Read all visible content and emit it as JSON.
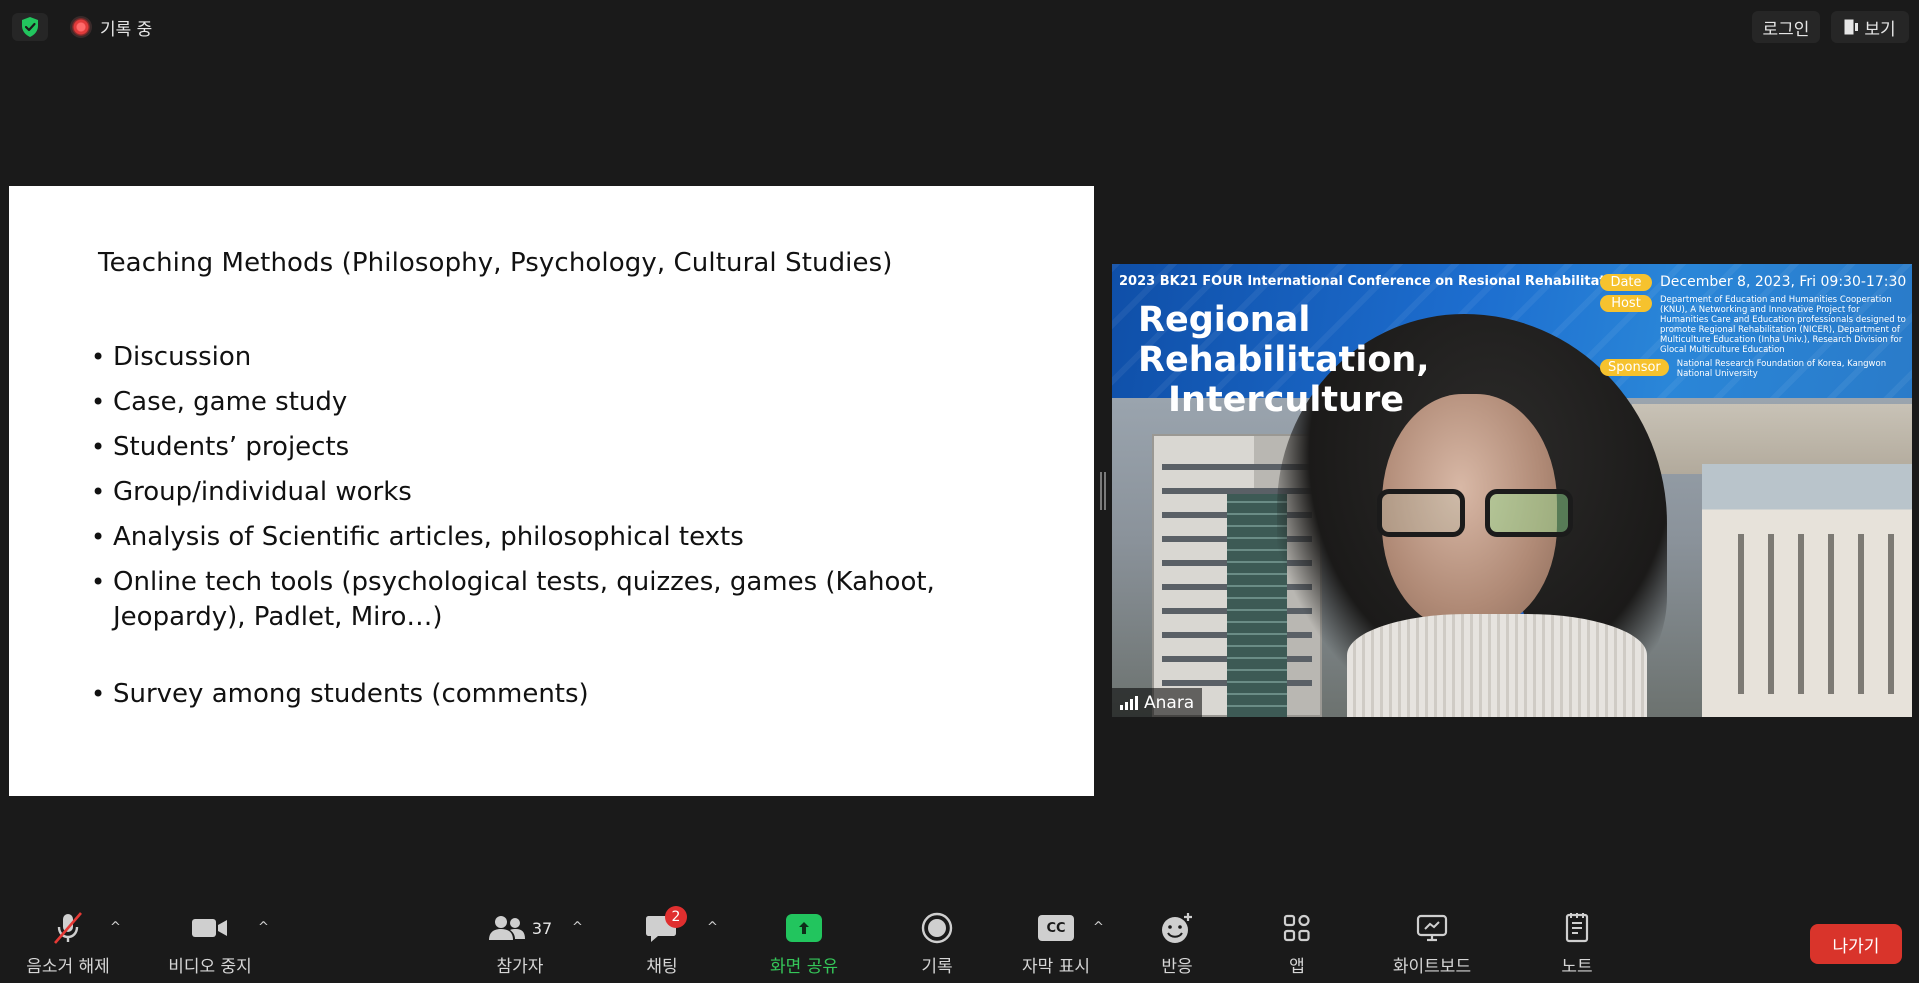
{
  "topbar": {
    "recording_label": "기록 중",
    "login_label": "로그인",
    "view_label": "보기"
  },
  "slide": {
    "title": "Teaching Methods (Philosophy, Psychology, Cultural Studies)",
    "bullets": [
      "Discussion",
      "Case, game study",
      "Students’ projects",
      "Group/individual works",
      "Analysis of Scientific articles, philosophical texts",
      "Online tech tools (psychological tests, quizzes, games (Kahoot, Jeopardy), Padlet, Miro…)",
      "Survey among students (comments)"
    ]
  },
  "video": {
    "participant_name": "Anara",
    "banner": {
      "conference": "2023 BK21 FOUR International Conference on Resional Rehabilitation",
      "headline_line1": "Regional Rehabilitation,",
      "headline_line2": "Interculture",
      "date_badge": "Date",
      "date_text": "December 8, 2023, Fri 09:30-17:30",
      "host_badge": "Host",
      "host_text": "Department of Education and Humanities Cooperation (KNU), A Networking and Innovative Project for Humanities Care and Education professionals designed to promote Regional Rehabilitation (NICER), Department of Multiculture Education (Inha Univ.), Research Division for Glocal Multiculture Education",
      "sponsor_badge": "Sponsor",
      "sponsor_text": "National Research Foundation of Korea, Kangwon National University"
    }
  },
  "toolbar": {
    "unmute_label": "음소거 해제",
    "stop_video_label": "비디오 중지",
    "participants_label": "참가자",
    "participants_count": "37",
    "chat_label": "채팅",
    "chat_badge": "2",
    "share_label": "화면 공유",
    "record_label": "기록",
    "captions_label": "자막 표시",
    "captions_icon_text": "CC",
    "reactions_label": "반응",
    "apps_label": "앱",
    "whiteboard_label": "화이트보드",
    "notes_label": "노트",
    "leave_label": "나가기"
  },
  "colors": {
    "accent_green": "#22c55e",
    "leave_red": "#d9342b",
    "badge_red": "#e02f2f",
    "background": "#1a1a1a"
  }
}
